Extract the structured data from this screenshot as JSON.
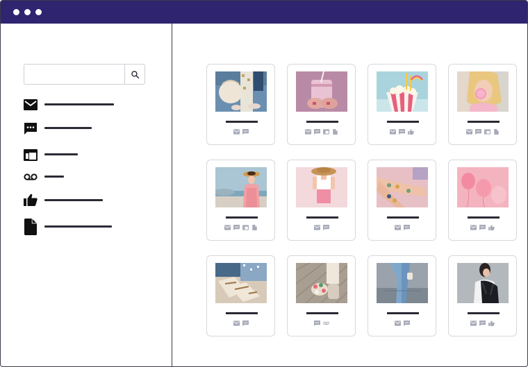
{
  "window": {
    "colors": {
      "titlebar": "#2e2470",
      "ink": "#2a2a35",
      "icon_gray": "#a6a9b6"
    }
  },
  "search": {
    "value": "",
    "placeholder": "",
    "icon": "search-icon"
  },
  "sidebar": {
    "items": [
      {
        "key": "mail",
        "icon": "mail-icon"
      },
      {
        "key": "chat",
        "icon": "chat-icon"
      },
      {
        "key": "web",
        "icon": "browser-window-icon"
      },
      {
        "key": "voicemail",
        "icon": "voicemail-icon"
      },
      {
        "key": "like",
        "icon": "thumbs-up-icon"
      },
      {
        "key": "file",
        "icon": "document-icon"
      }
    ]
  },
  "gallery": {
    "cards": [
      {
        "photo": "clutch-bag-photo",
        "icons": [
          "mail",
          "chat"
        ]
      },
      {
        "photo": "pink-drink-photo",
        "icons": [
          "mail",
          "chat",
          "web",
          "file"
        ]
      },
      {
        "photo": "popcorn-photo",
        "icons": [
          "mail",
          "chat",
          "like"
        ]
      },
      {
        "photo": "bubble-gum-photo",
        "icons": [
          "mail",
          "chat",
          "web",
          "file"
        ]
      },
      {
        "photo": "seaside-hat-photo",
        "icons": [
          "mail",
          "chat",
          "web",
          "file"
        ]
      },
      {
        "photo": "straw-hat-photo",
        "icons": [
          "mail",
          "chat"
        ]
      },
      {
        "photo": "tattoo-arms-photo",
        "icons": [
          "mail",
          "chat"
        ]
      },
      {
        "photo": "pink-balloons-photo",
        "icons": [
          "mail",
          "chat",
          "like"
        ]
      },
      {
        "photo": "sandals-photo",
        "icons": [
          "mail",
          "chat"
        ]
      },
      {
        "photo": "flower-sandals-photo",
        "icons": [
          "chat",
          "voicemail"
        ]
      },
      {
        "photo": "denim-legs-photo",
        "icons": [
          "mail",
          "chat"
        ]
      },
      {
        "photo": "backpack-woman-photo",
        "icons": [
          "mail",
          "chat",
          "like"
        ]
      }
    ]
  }
}
